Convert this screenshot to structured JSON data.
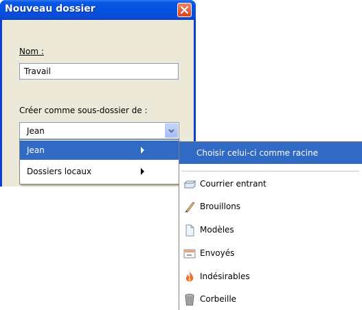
{
  "dialog": {
    "title": "Nouveau dossier",
    "name_label": "Nom :",
    "name_value": "Travail",
    "parent_label": "Créer comme sous-dossier de :",
    "parent_value": "Jean"
  },
  "menu": {
    "items": [
      {
        "label": "Jean",
        "icon": "submenu-arrow",
        "highlighted": true
      },
      {
        "label": "Dossiers locaux",
        "icon": "submenu-arrow",
        "highlighted": false
      }
    ]
  },
  "submenu": {
    "header": "Choisir celui-ci comme racine",
    "items": [
      {
        "label": "Courrier entrant",
        "icon": "inbox-icon"
      },
      {
        "label": "Brouillons",
        "icon": "drafts-icon"
      },
      {
        "label": "Modèles",
        "icon": "templates-icon"
      },
      {
        "label": "Envoyés",
        "icon": "sent-icon"
      },
      {
        "label": "Indésirables",
        "icon": "junk-icon"
      },
      {
        "label": "Corbeille",
        "icon": "trash-icon"
      }
    ]
  },
  "colors": {
    "highlight": "#316ac5",
    "titlebar": "#0452e0",
    "client": "#ece9d8"
  }
}
